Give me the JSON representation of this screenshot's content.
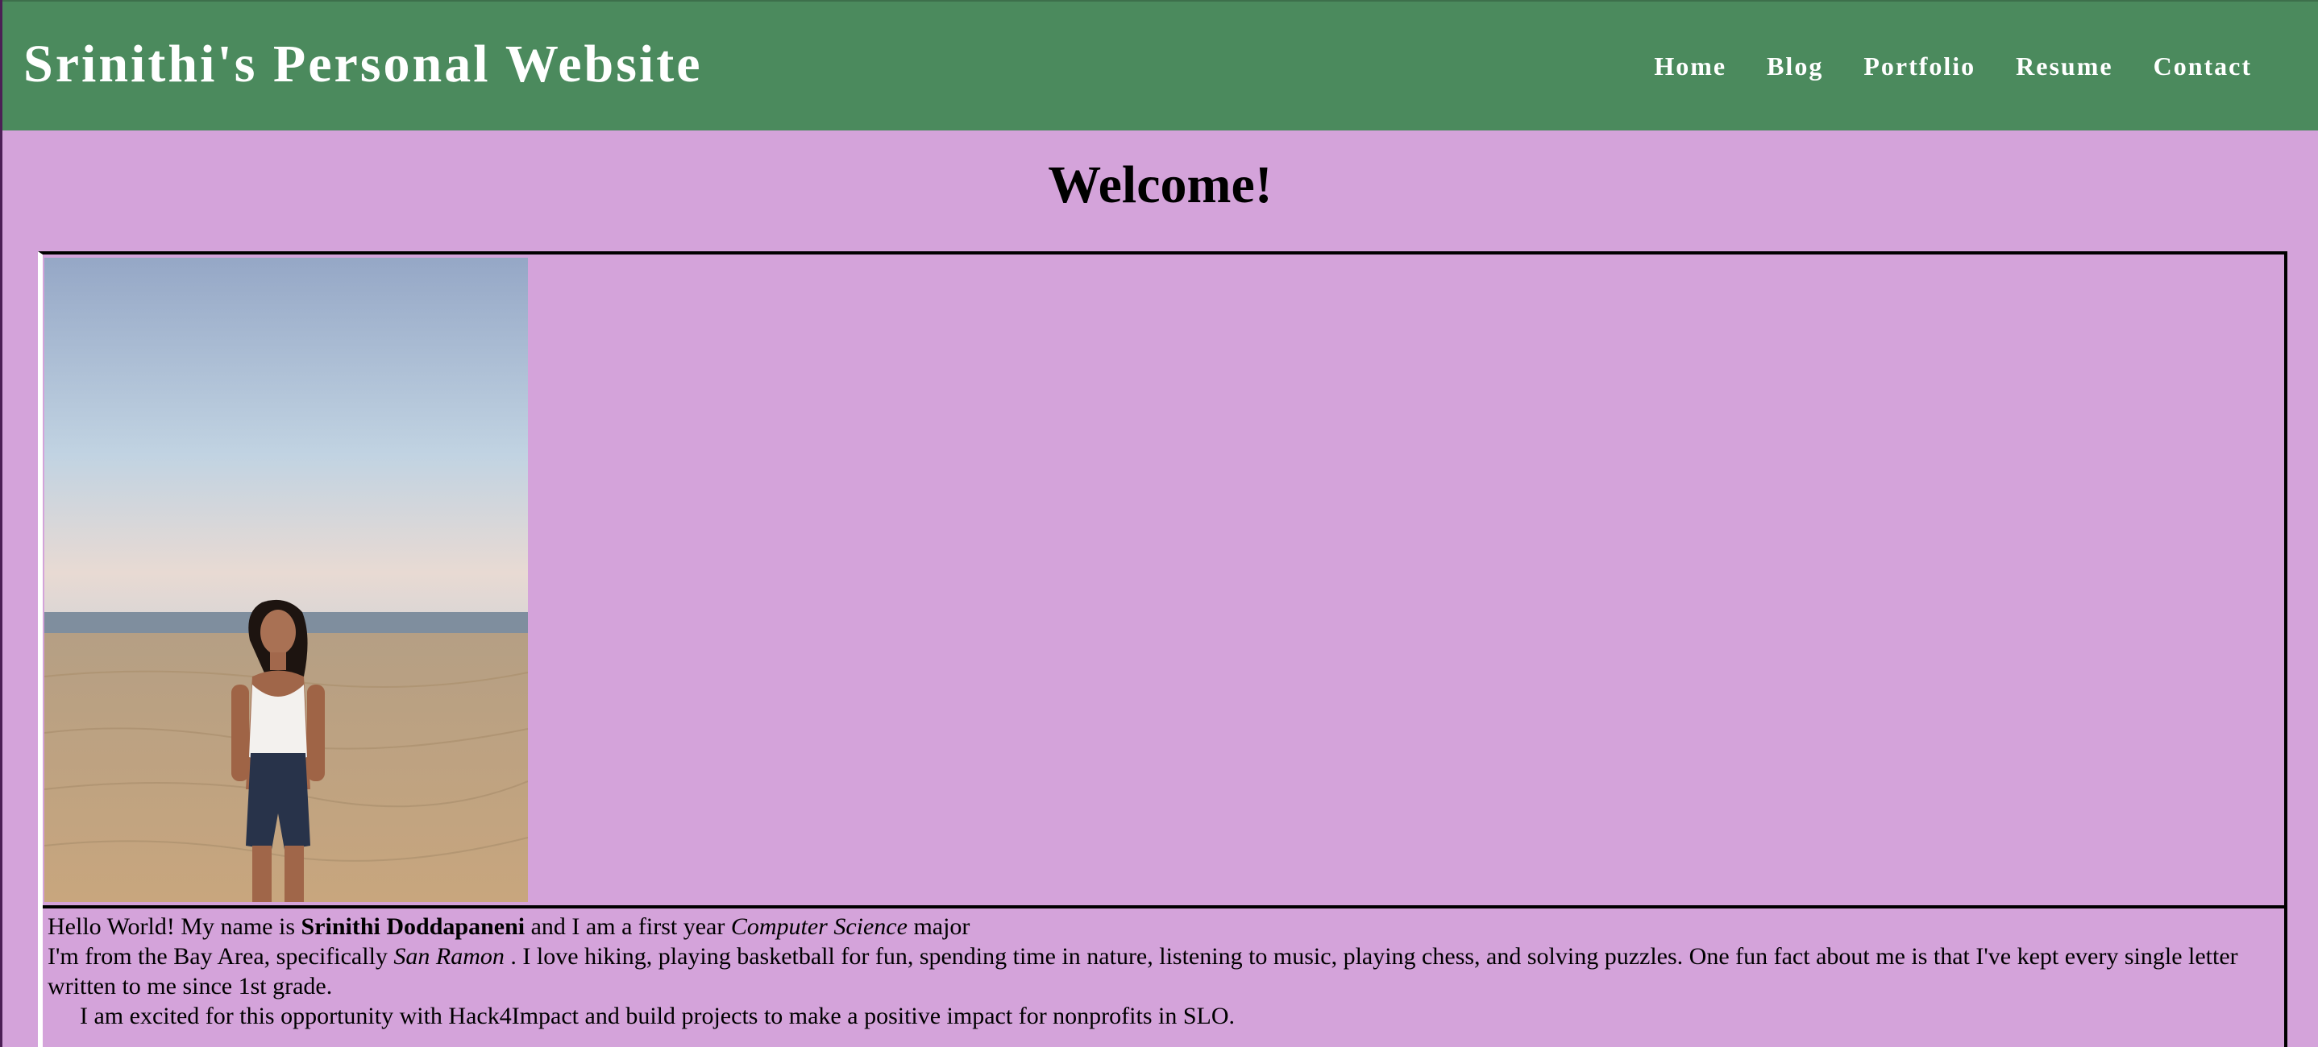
{
  "header": {
    "site_title": "Srinithi's Personal Website",
    "nav": [
      {
        "label": "Home"
      },
      {
        "label": "Blog"
      },
      {
        "label": "Portfolio"
      },
      {
        "label": "Resume"
      },
      {
        "label": "Contact"
      }
    ]
  },
  "main": {
    "heading": "Welcome!",
    "intro": {
      "line1_prefix": "Hello World! My name is ",
      "name": "Srinithi Doddapaneni",
      "line1_middle": " and I am a first year ",
      "major": "Computer Science",
      "line1_suffix": " major",
      "line2_prefix": "I'm from the Bay Area, specifically ",
      "city": "San Ramon",
      "line2_suffix": " . I love hiking, playing basketball for fun, spending time in nature, listening to music, playing chess, and solving puzzles. One fun fact about me is that I've kept every single letter written to me since 1st grade.",
      "line3": "I am excited for this opportunity with Hack4Impact and build projects to make a positive impact for nonprofits in SLO."
    }
  },
  "colors": {
    "page_background": "#d4a3da",
    "header_background": "#4b8a5d",
    "header_text": "#ffffff"
  }
}
